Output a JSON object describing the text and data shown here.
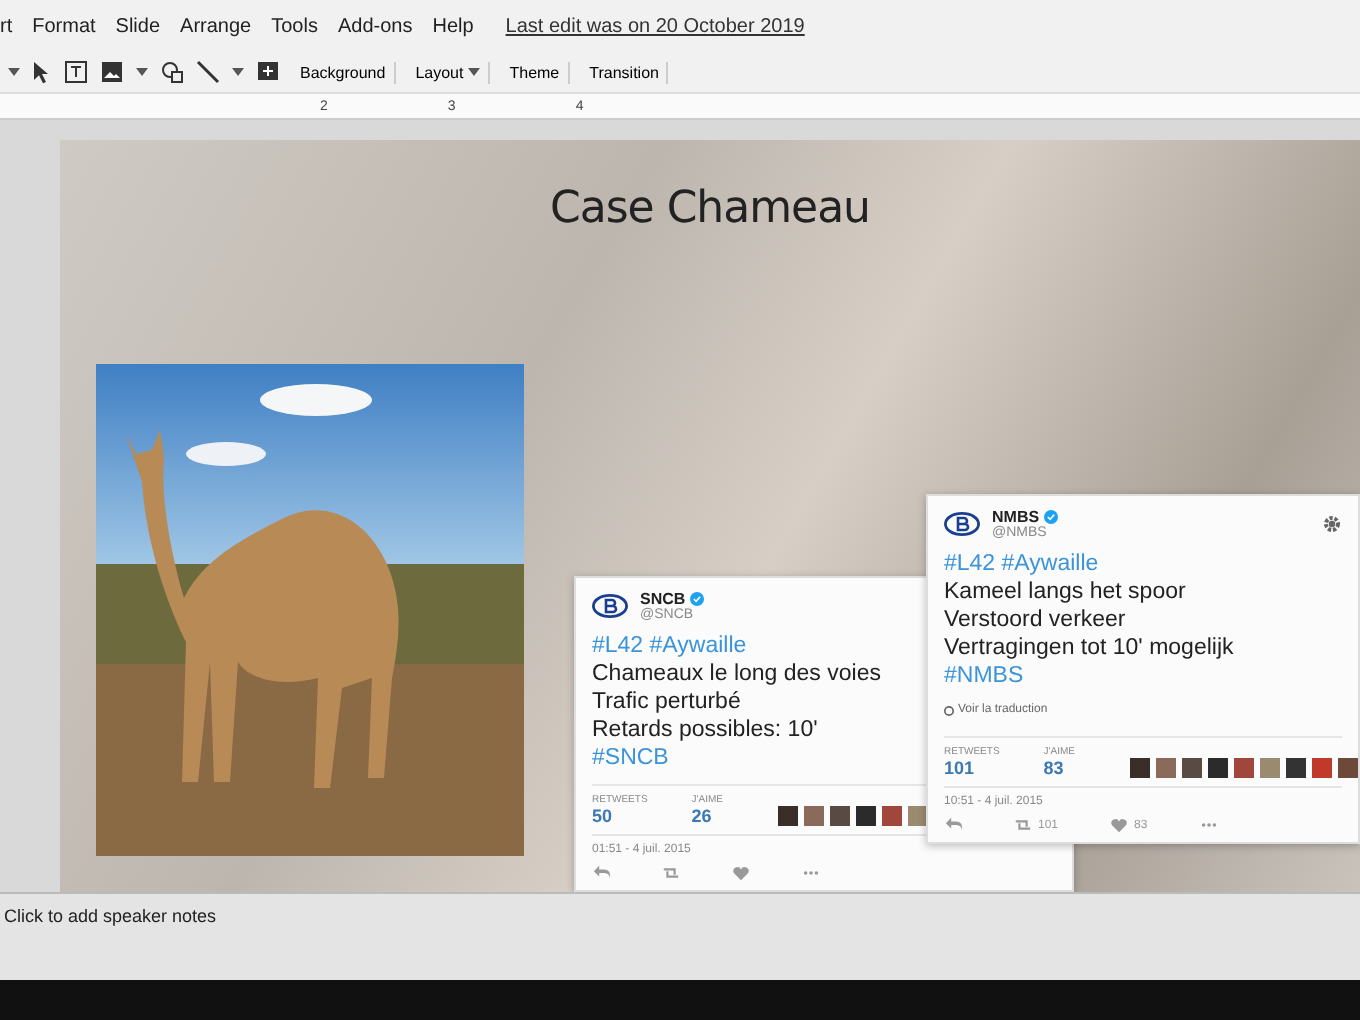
{
  "menu": {
    "items": [
      {
        "label": "rt"
      },
      {
        "label": "Format"
      },
      {
        "label": "Slide"
      },
      {
        "label": "Arrange"
      },
      {
        "label": "Tools"
      },
      {
        "label": "Add-ons"
      },
      {
        "label": "Help"
      }
    ],
    "last_edit": "Last edit was on 20 October 2019"
  },
  "toolbar": {
    "buttons": [
      {
        "label": "Background",
        "dropdown": false
      },
      {
        "label": "Layout",
        "dropdown": true
      },
      {
        "label": "Theme",
        "dropdown": false
      },
      {
        "label": "Transition",
        "dropdown": false
      }
    ]
  },
  "ruler": {
    "marks": [
      "2",
      "3",
      "4"
    ]
  },
  "slide": {
    "title": "Case Chameau",
    "tweets": [
      {
        "account": "SNCB",
        "handle": "@SNCB",
        "verified": true,
        "settings": false,
        "lines": [
          {
            "kind": "hashtag",
            "text": "#L42 #Aywaille"
          },
          {
            "kind": "text",
            "text": "Chameaux le long des voies"
          },
          {
            "kind": "text",
            "text": "Trafic perturbé"
          },
          {
            "kind": "text",
            "text": "Retards possibles: 10'"
          },
          {
            "kind": "hashtag",
            "text": "#SNCB"
          }
        ],
        "stats": [
          {
            "label": "RETWEETS",
            "value": "50"
          },
          {
            "label": "J'AIME",
            "value": "26"
          }
        ],
        "time": "01:51 - 4 juil. 2015",
        "actions": [
          {
            "kind": "reply"
          },
          {
            "kind": "retweet"
          },
          {
            "kind": "like"
          },
          {
            "kind": "more"
          }
        ]
      },
      {
        "account": "NMBS",
        "handle": "@NMBS",
        "verified": true,
        "settings": true,
        "lines": [
          {
            "kind": "hashtag",
            "text": "#L42 #Aywaille"
          },
          {
            "kind": "text",
            "text": "Kameel langs het spoor"
          },
          {
            "kind": "text",
            "text": "Verstoord verkeer"
          },
          {
            "kind": "text",
            "text": "Vertragingen tot 10' mogelijk"
          },
          {
            "kind": "hashtag",
            "text": "#NMBS"
          }
        ],
        "translate_link": "Voir la traduction",
        "stats": [
          {
            "label": "RETWEETS",
            "value": "101"
          },
          {
            "label": "J'AIME",
            "value": "83"
          }
        ],
        "time": "10:51 - 4 juil. 2015",
        "actions": [
          {
            "kind": "reply"
          },
          {
            "kind": "retweet",
            "count": "101"
          },
          {
            "kind": "like",
            "count": "83"
          },
          {
            "kind": "more"
          }
        ]
      }
    ]
  },
  "speaker_notes": {
    "placeholder": "Click to add speaker notes"
  }
}
